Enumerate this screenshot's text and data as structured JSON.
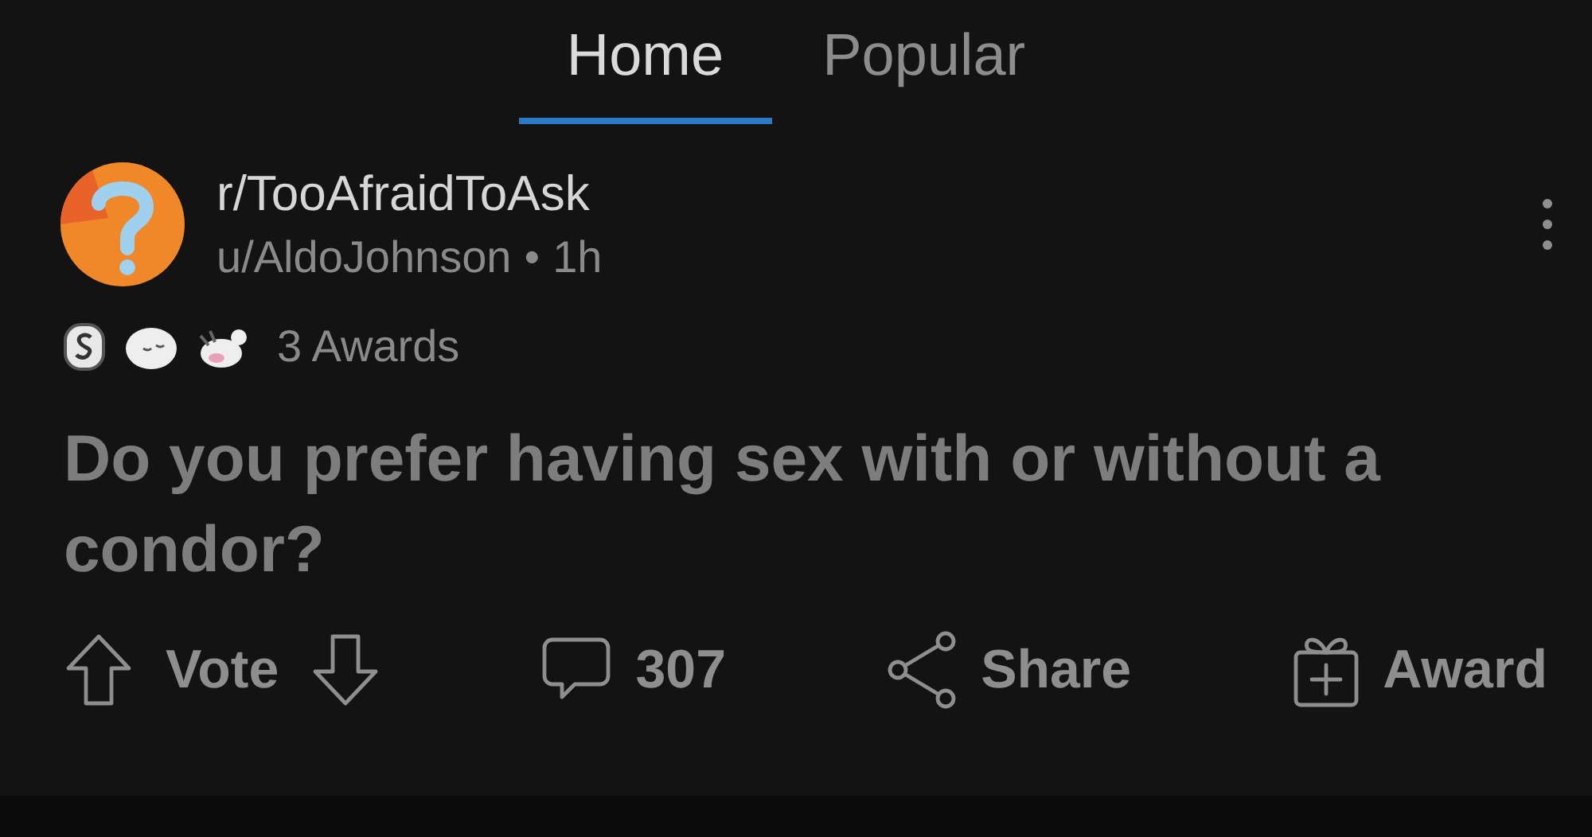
{
  "tabs": [
    {
      "label": "Home",
      "selected": true
    },
    {
      "label": "Popular",
      "selected": false
    }
  ],
  "post": {
    "subreddit": "r/TooAfraidToAsk",
    "author": "u/AldoJohnson",
    "separator": "•",
    "age": "1h",
    "awards": {
      "label": "3 Awards"
    },
    "title": "Do you prefer having sex with or without a condor?",
    "actions": [
      {
        "kind": "vote",
        "label": "Vote"
      },
      {
        "kind": "comments",
        "label": "307"
      },
      {
        "kind": "share",
        "label": "Share"
      },
      {
        "kind": "award",
        "label": "Award"
      }
    ]
  }
}
